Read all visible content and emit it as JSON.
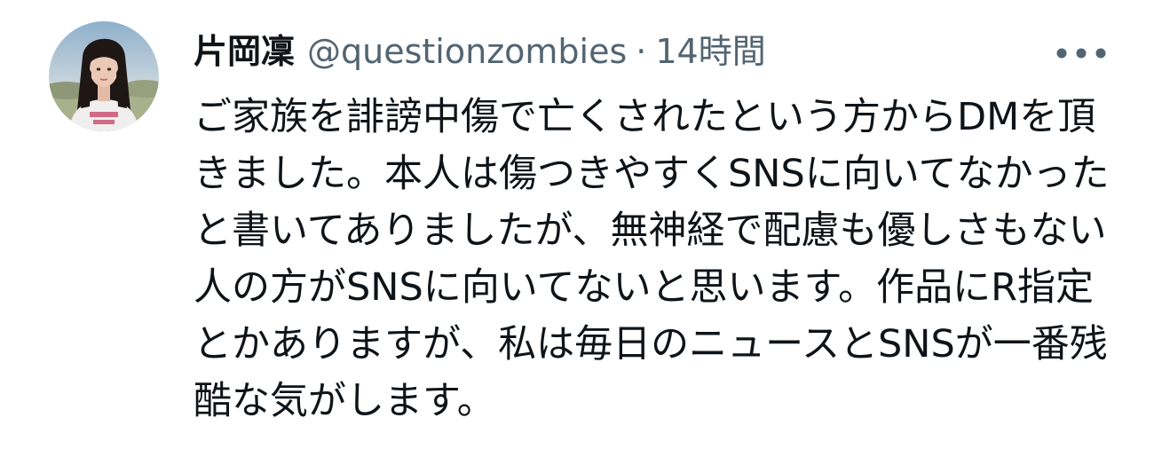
{
  "tweet": {
    "author": {
      "display_name": "片岡凜",
      "handle": "@questionzombies"
    },
    "separator": "·",
    "timestamp": "14時間",
    "body": "ご家族を誹謗中傷で亡くされたという方からDMを頂きました。本人は傷つきやすくSNSに向いてなかったと書いてありましたが、無神経で配慮も優しさもない人の方がSNSに向いてないと思います。作品にR指定とかありますが、私は毎日のニュースとSNSが一番残酷な気がします。",
    "icons": {
      "avatar": "profile-photo",
      "more": "more-horizontal-icon"
    },
    "colors": {
      "text_primary": "#0f1419",
      "text_secondary": "#536471"
    }
  }
}
